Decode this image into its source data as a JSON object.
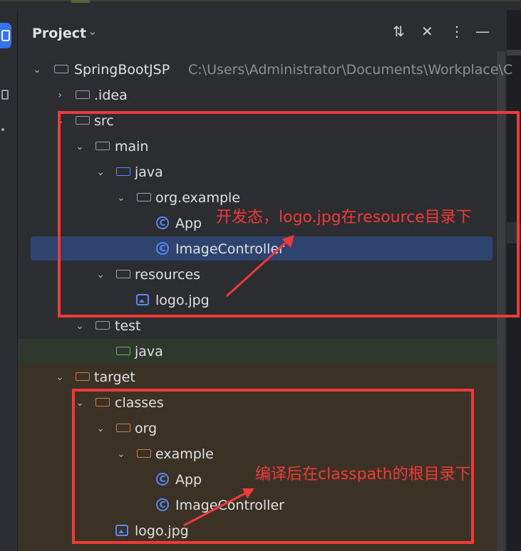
{
  "panel": {
    "title": "Project",
    "title_chevron": "⌄",
    "tools": [
      "⇅",
      "✕",
      "⋮",
      "—"
    ]
  },
  "tree": [
    {
      "id": "root",
      "label": "SpringBootJSP",
      "path": "C:\\Users\\Administrator\\Documents\\Workplace\\C",
      "arrow": "⌄",
      "icon": "project-folder",
      "color": "grey"
    },
    {
      "id": "idea",
      "label": ".idea",
      "arrow": "›",
      "icon": "folder",
      "color": "grey"
    },
    {
      "id": "src",
      "label": "src",
      "arrow": "⌄",
      "icon": "folder",
      "color": "grey"
    },
    {
      "id": "main",
      "label": "main",
      "arrow": "⌄",
      "icon": "folder",
      "color": "grey"
    },
    {
      "id": "java",
      "label": "java",
      "arrow": "⌄",
      "icon": "folder",
      "color": "blue"
    },
    {
      "id": "orgexample",
      "label": "org.example",
      "arrow": "⌄",
      "icon": "package",
      "color": "grey"
    },
    {
      "id": "app",
      "label": "App",
      "icon": "class-run"
    },
    {
      "id": "imagecontroller",
      "label": "ImageController",
      "icon": "class"
    },
    {
      "id": "resources",
      "label": "resources",
      "arrow": "⌄",
      "icon": "resource-folder",
      "color": "grey"
    },
    {
      "id": "logo",
      "label": "logo.jpg",
      "icon": "image"
    },
    {
      "id": "test",
      "label": "test",
      "arrow": "⌄",
      "icon": "folder",
      "color": "grey"
    },
    {
      "id": "testjava",
      "label": "java",
      "icon": "folder",
      "color": "green"
    },
    {
      "id": "target",
      "label": "target",
      "arrow": "⌄",
      "icon": "folder",
      "color": "orange"
    },
    {
      "id": "classes",
      "label": "classes",
      "arrow": "⌄",
      "icon": "folder",
      "color": "orange"
    },
    {
      "id": "org",
      "label": "org",
      "arrow": "⌄",
      "icon": "folder",
      "color": "orange"
    },
    {
      "id": "example",
      "label": "example",
      "arrow": "⌄",
      "icon": "folder",
      "color": "orange"
    },
    {
      "id": "app2",
      "label": "App",
      "icon": "class-run"
    },
    {
      "id": "imagecontroller2",
      "label": "ImageController",
      "icon": "class"
    },
    {
      "id": "logo2",
      "label": "logo.jpg",
      "icon": "image"
    }
  ],
  "annotations": {
    "dev_note": "开发态，logo.jpg在resource目录下",
    "build_note": "编译后在classpath的根目录下"
  },
  "colors": {
    "annotation": "#f03a3a",
    "selection": "#2e436e",
    "accent": "#3574f0"
  }
}
